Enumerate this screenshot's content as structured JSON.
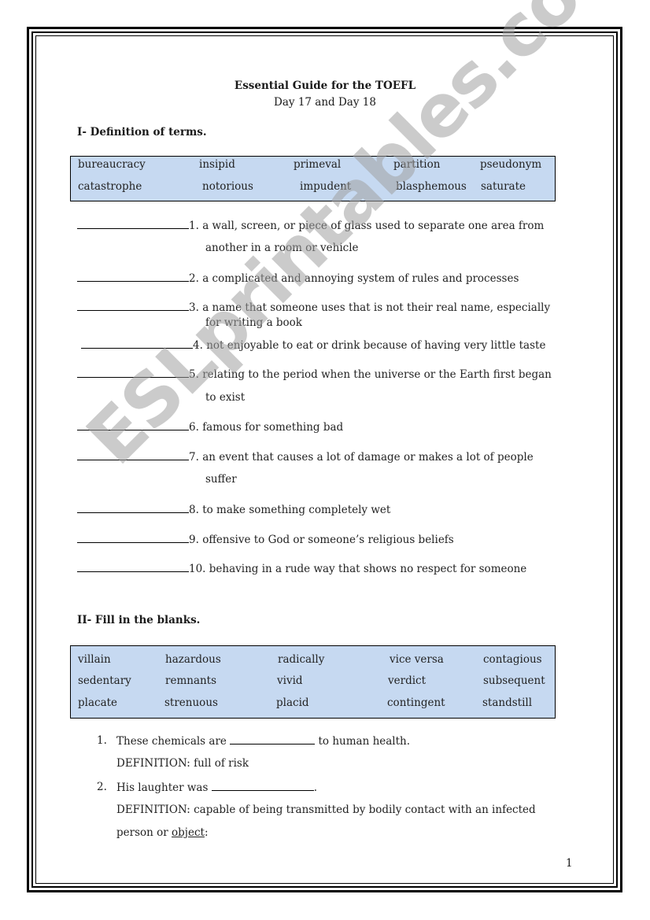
{
  "document": {
    "title": "Essential Guide for the TOEFL",
    "subtitle": "Day 17 and Day 18",
    "page_number": "1",
    "watermark": "ESLprintables.com"
  },
  "section1": {
    "heading": "I- Definition of terms.",
    "word_bank": [
      [
        "bureaucracy",
        "insipid",
        "primeval",
        "partition",
        "pseudonym"
      ],
      [
        "catastrophe",
        "notorious",
        "impudent",
        "blasphemous",
        "saturate"
      ]
    ],
    "definitions": [
      {
        "number": "1.",
        "text": "a wall, screen, or piece of glass used to separate one area from",
        "continuation": "another in a room or vehicle"
      },
      {
        "number": "2.",
        "text": "a complicated and annoying system of rules and processes",
        "continuation": null
      },
      {
        "number": "3.",
        "text": "a name that someone uses that is not their real name, especially",
        "continuation": "for writing a book"
      },
      {
        "number": "4.",
        "text": "not enjoyable to eat or drink because of having very little taste",
        "continuation": null
      },
      {
        "number": "5.",
        "text": "relating to the period when the universe or the Earth first began",
        "continuation": "to exist"
      },
      {
        "number": "6.",
        "text": "famous for something bad",
        "continuation": null
      },
      {
        "number": "7.",
        "text": "an event that causes a lot of damage or makes a lot of people",
        "continuation": "suffer"
      },
      {
        "number": "8.",
        "text": "to make something completely wet",
        "continuation": null
      },
      {
        "number": "9.",
        "text": "offensive to God or someone’s religious beliefs",
        "continuation": null
      },
      {
        "number": "10.",
        "text": "behaving in a rude way that shows no respect for someone",
        "continuation": null
      }
    ]
  },
  "section2": {
    "heading": "II- Fill in the blanks.",
    "word_bank": [
      [
        "villain",
        "hazardous",
        "radically",
        "vice versa",
        "contagious"
      ],
      [
        "sedentary",
        "remnants",
        "vivid",
        "verdict",
        "subsequent"
      ],
      [
        "placate",
        "strenuous",
        "placid",
        "contingent",
        "standstill"
      ]
    ],
    "questions": [
      {
        "number": "1.",
        "before_blank": "These chemicals are",
        "after_blank": "to human health.",
        "definition_label": "DEFINITION:",
        "definition": "full of risk"
      },
      {
        "number": "2.",
        "before_blank": "His laughter was",
        "after_blank": ".",
        "definition_label": "DEFINITION:",
        "definition": "capable of being transmitted by bodily contact with an infected",
        "definition_cont_before_link": "person or",
        "definition_link": "object",
        "definition_cont_after_link": ":"
      }
    ]
  }
}
